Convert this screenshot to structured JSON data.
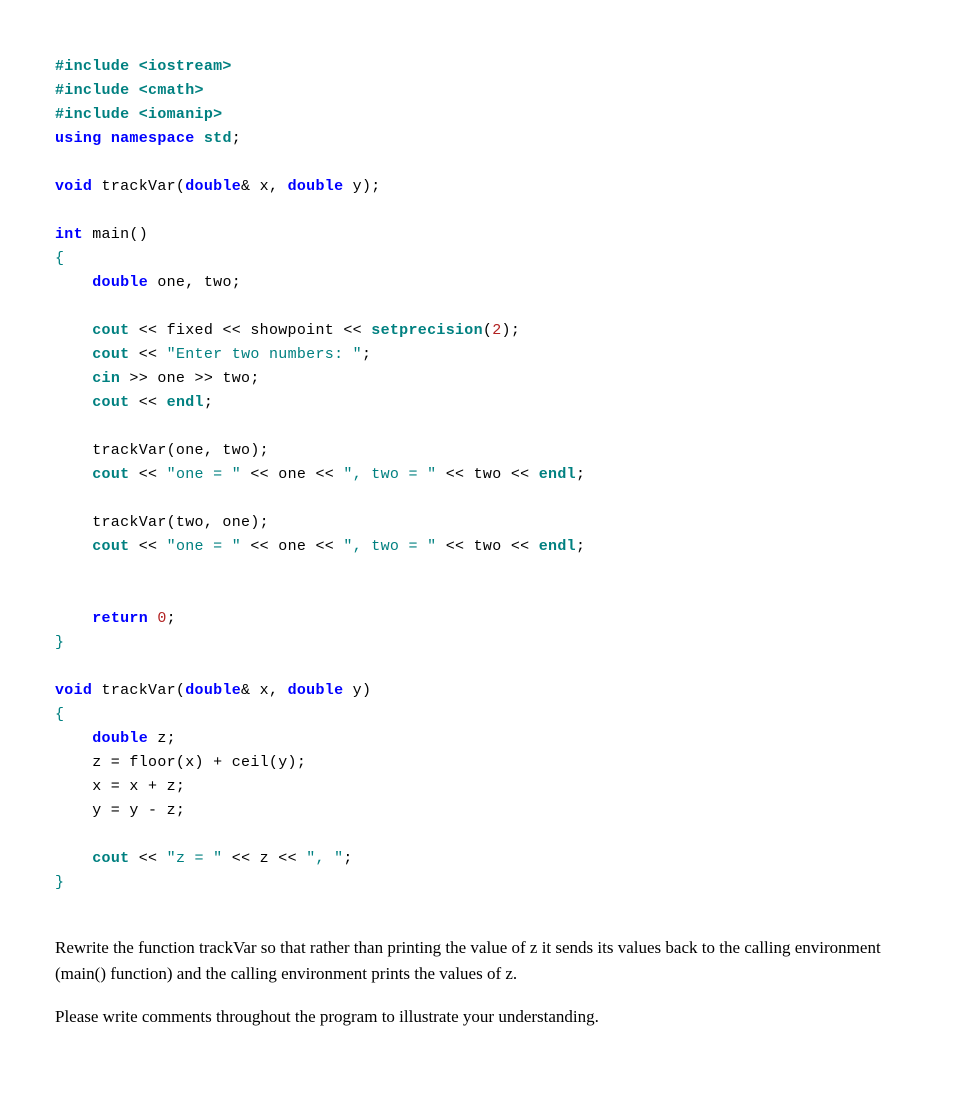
{
  "code": {
    "l1a": "#include <iostream>",
    "l2a": "#include <cmath>",
    "l3a": "#include <iomanip>",
    "l4a": "using",
    "l4b": " ",
    "l4c": "namespace",
    "l4d": " ",
    "l4e": "std",
    "l4f": ";",
    "l6a": "void",
    "l6b": " trackVar(",
    "l6c": "double",
    "l6d": "& x, ",
    "l6e": "double",
    "l6f": " y);",
    "l8a": "int",
    "l8b": " main()",
    "l9a": "{",
    "l10a": "    ",
    "l10b": "double",
    "l10c": " one, two;",
    "l12a": "    ",
    "l12b": "cout",
    "l12c": " << fixed << showpoint << ",
    "l12d": "setprecision",
    "l12e": "(",
    "l12f": "2",
    "l12g": ");",
    "l13a": "    ",
    "l13b": "cout",
    "l13c": " << ",
    "l13d": "\"Enter two numbers: \"",
    "l13e": ";",
    "l14a": "    ",
    "l14b": "cin",
    "l14c": " >> one >> two;",
    "l15a": "    ",
    "l15b": "cout",
    "l15c": " << ",
    "l15d": "endl",
    "l15e": ";",
    "l17a": "    trackVar(one, two);",
    "l18a": "    ",
    "l18b": "cout",
    "l18c": " << ",
    "l18d": "\"one = \"",
    "l18e": " << one << ",
    "l18f": "\", two = \"",
    "l18g": " << two << ",
    "l18h": "endl",
    "l18i": ";",
    "l20a": "    trackVar(two, one);",
    "l21a": "    ",
    "l21b": "cout",
    "l21c": " << ",
    "l21d": "\"one = \"",
    "l21e": " << one << ",
    "l21f": "\", two = \"",
    "l21g": " << two << ",
    "l21h": "endl",
    "l21i": ";",
    "l24a": "    ",
    "l24b": "return",
    "l24c": " ",
    "l24d": "0",
    "l24e": ";",
    "l25a": "}",
    "l27a": "void",
    "l27b": " trackVar(",
    "l27c": "double",
    "l27d": "& x, ",
    "l27e": "double",
    "l27f": " y)",
    "l28a": "{",
    "l29a": "    ",
    "l29b": "double",
    "l29c": " z;",
    "l30a": "    z = floor(x) + ceil(y);",
    "l31a": "    x = x + z;",
    "l32a": "    y = y - z;",
    "l34a": "    ",
    "l34b": "cout",
    "l34c": " << ",
    "l34d": "\"z = \"",
    "l34e": " << z << ",
    "l34f": "\", \"",
    "l34g": ";",
    "l35a": "}"
  },
  "instructions": {
    "p1": "Rewrite the function trackVar so that rather than printing the value of z it sends its values back to the calling environment (main() function) and the calling environment prints the values of z.",
    "p2": "Please write comments throughout the program to illustrate your understanding."
  }
}
